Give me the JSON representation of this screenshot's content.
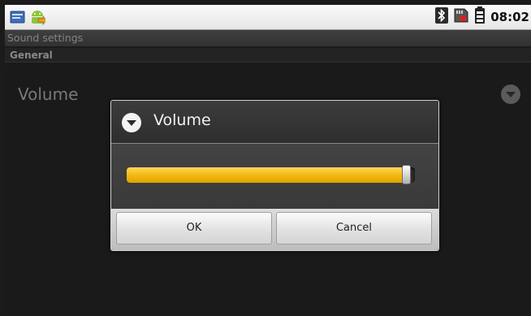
{
  "status_bar": {
    "time": "08:02",
    "icons": [
      "notification-icon",
      "android-update-icon",
      "bluetooth-icon",
      "sd-card-icon",
      "battery-icon"
    ]
  },
  "screen": {
    "title": "Sound settings",
    "section_header": "General",
    "preference": {
      "title": "Volume"
    }
  },
  "dialog": {
    "title": "Volume",
    "slider_value_fraction": 0.985,
    "ok_label": "OK",
    "cancel_label": "Cancel",
    "accent_color": "#f2b70f"
  }
}
